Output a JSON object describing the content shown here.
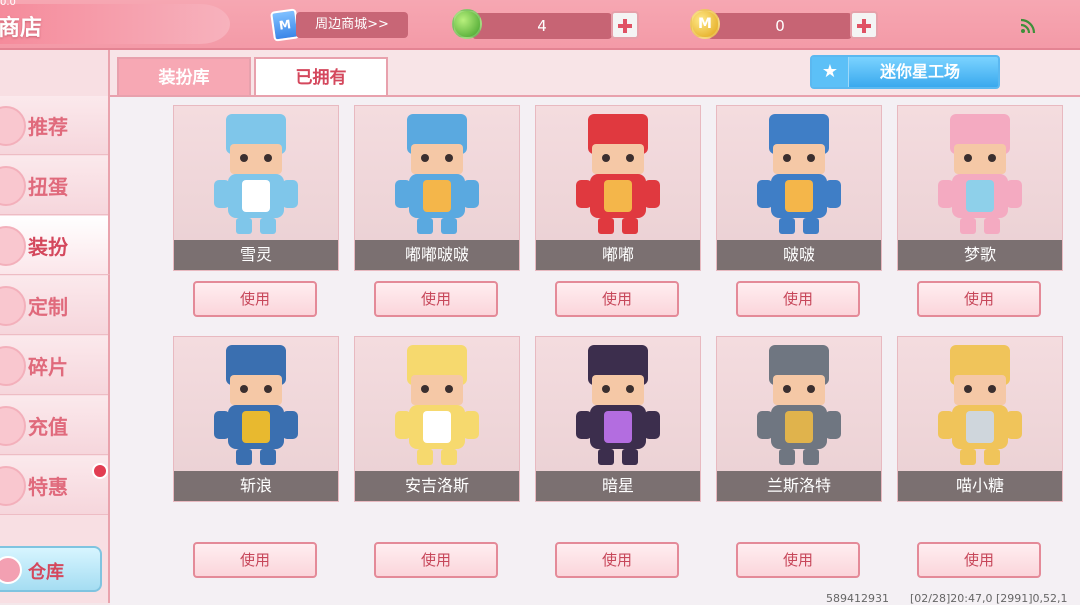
{
  "header": {
    "version": "0.0",
    "title": "商店",
    "mall_icon_text": "M",
    "mall_label": "周边商城>>",
    "mini_bean_count": "4",
    "mini_coin_count": "0",
    "mini_bean_icon_text": "",
    "mini_coin_icon_text": "M"
  },
  "sidebar": {
    "items": [
      {
        "label": "推荐"
      },
      {
        "label": "扭蛋"
      },
      {
        "label": "装扮"
      },
      {
        "label": "定制"
      },
      {
        "label": "碎片"
      },
      {
        "label": "充值"
      },
      {
        "label": "特惠"
      }
    ],
    "warehouse_label": "仓库"
  },
  "tabs": [
    {
      "label": "装扮库"
    },
    {
      "label": "已拥有"
    }
  ],
  "workshop": {
    "label": "迷你星工场",
    "icon": "★"
  },
  "skins": [
    {
      "name": "雪灵",
      "button": "使用",
      "colors": [
        "#7fc6ea",
        "#ffffff"
      ]
    },
    {
      "name": "嘟嘟啵啵",
      "button": "使用",
      "colors": [
        "#5aa9e0",
        "#f4b64a"
      ]
    },
    {
      "name": "嘟嘟",
      "button": "使用",
      "colors": [
        "#e0393f",
        "#f4b64a"
      ]
    },
    {
      "name": "啵啵",
      "button": "使用",
      "colors": [
        "#3f7ec6",
        "#f4b64a"
      ]
    },
    {
      "name": "梦歌",
      "button": "使用",
      "colors": [
        "#f4aac1",
        "#8ed0ea"
      ]
    },
    {
      "name": "斩浪",
      "button": "使用",
      "colors": [
        "#3a6fb0",
        "#e8b92f"
      ]
    },
    {
      "name": "安吉洛斯",
      "button": "使用",
      "colors": [
        "#f6d96e",
        "#ffffff"
      ]
    },
    {
      "name": "暗星",
      "button": "使用",
      "colors": [
        "#3c2e4d",
        "#b36de0"
      ]
    },
    {
      "name": "兰斯洛特",
      "button": "使用",
      "colors": [
        "#6f7681",
        "#e0b34c"
      ]
    },
    {
      "name": "喵小糖",
      "button": "使用",
      "colors": [
        "#f0c45a",
        "#cfd6dc"
      ]
    }
  ],
  "footer": {
    "uid": "589412931",
    "info": "[02/28]20:47,0 [2991]0,52,1"
  },
  "colors": {
    "accent": "#e06a7c",
    "topbar": "#f49aa7",
    "workshop": "#3aa9ee"
  },
  "icons": {
    "rss": "feed-icon"
  }
}
